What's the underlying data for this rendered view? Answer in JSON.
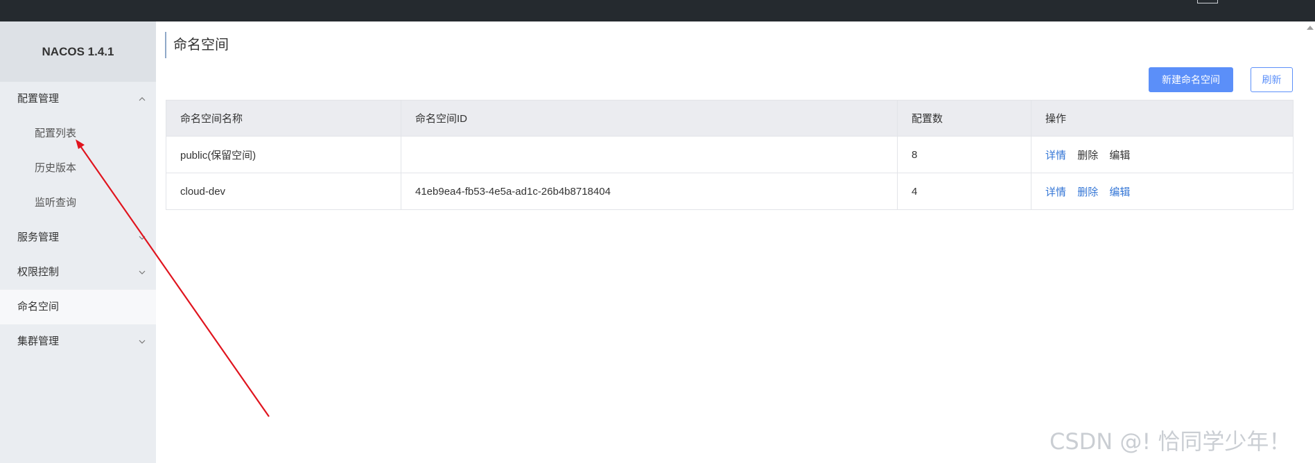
{
  "app": {
    "brand": "NACOS 1.4.1"
  },
  "sidebar": {
    "items": [
      {
        "label": "配置管理",
        "chevron": "up"
      },
      {
        "label": "配置列表"
      },
      {
        "label": "历史版本"
      },
      {
        "label": "监听查询"
      },
      {
        "label": "服务管理",
        "chevron": "down"
      },
      {
        "label": "权限控制",
        "chevron": "down"
      },
      {
        "label": "命名空间",
        "active": true
      },
      {
        "label": "集群管理",
        "chevron": "down"
      }
    ]
  },
  "page": {
    "title": "命名空间",
    "create_button": "新建命名空间",
    "refresh_button": "刷新"
  },
  "table": {
    "columns": [
      "命名空间名称",
      "命名空间ID",
      "配置数",
      "操作"
    ],
    "rows": [
      {
        "name": "public(保留空间)",
        "id": "",
        "count": "8",
        "ops": [
          "详情",
          "删除",
          "编辑"
        ]
      },
      {
        "name": "cloud-dev",
        "id": "41eb9ea4-fb53-4e5a-ad1c-26b4b8718404",
        "count": "4",
        "ops": [
          "详情",
          "删除",
          "编辑"
        ]
      }
    ]
  },
  "watermark": "CSDN @! 恰同学少年！",
  "colors": {
    "accent": "#5b8ff9",
    "link": "#3476d6",
    "topbar": "#252a2f",
    "annotation": "#e0141e"
  }
}
